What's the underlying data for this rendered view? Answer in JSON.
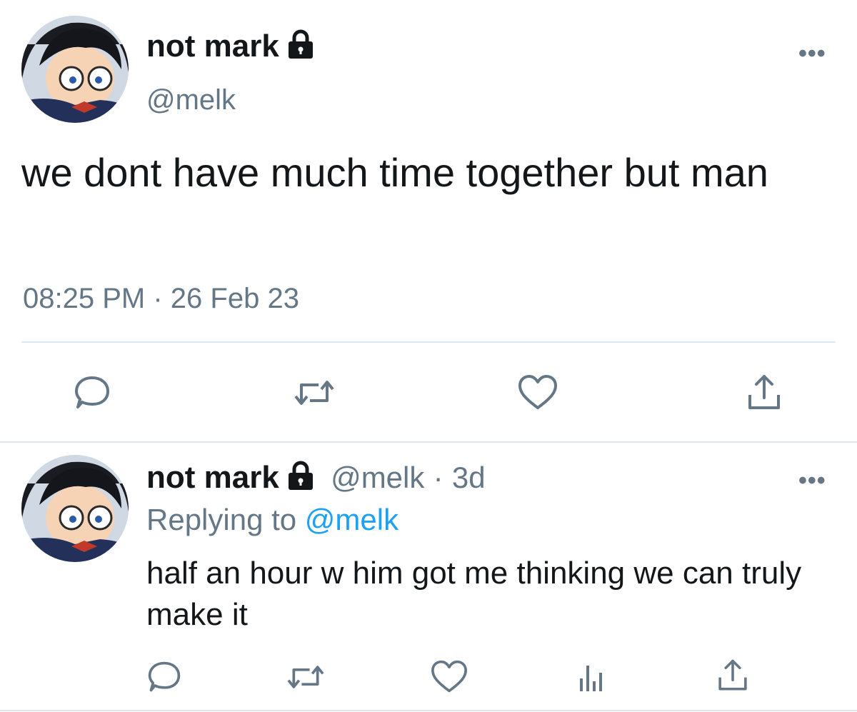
{
  "main_tweet": {
    "display_name": "not mark",
    "handle": "@melk",
    "text": "we dont have much time together but man",
    "time": "08:25 PM",
    "date_separator": "·",
    "date": "26 Feb 23",
    "more": "•••"
  },
  "reply_tweet": {
    "display_name": "not mark",
    "handle": "@melk",
    "separator": "·",
    "age": "3d",
    "replying_prefix": "Replying to",
    "replying_to": "@melk",
    "text": "half an hour w him got me thinking we can truly make it",
    "more": "•••"
  },
  "colors": {
    "text": "#14171a",
    "secondary": "#657786",
    "accent": "#1da1f2",
    "divider": "#e1e8ed"
  },
  "icons": {
    "lock": "lock-icon",
    "reply": "comment-icon",
    "retweet": "retweet-icon",
    "like": "heart-icon",
    "share": "share-icon",
    "analytics": "analytics-icon"
  }
}
